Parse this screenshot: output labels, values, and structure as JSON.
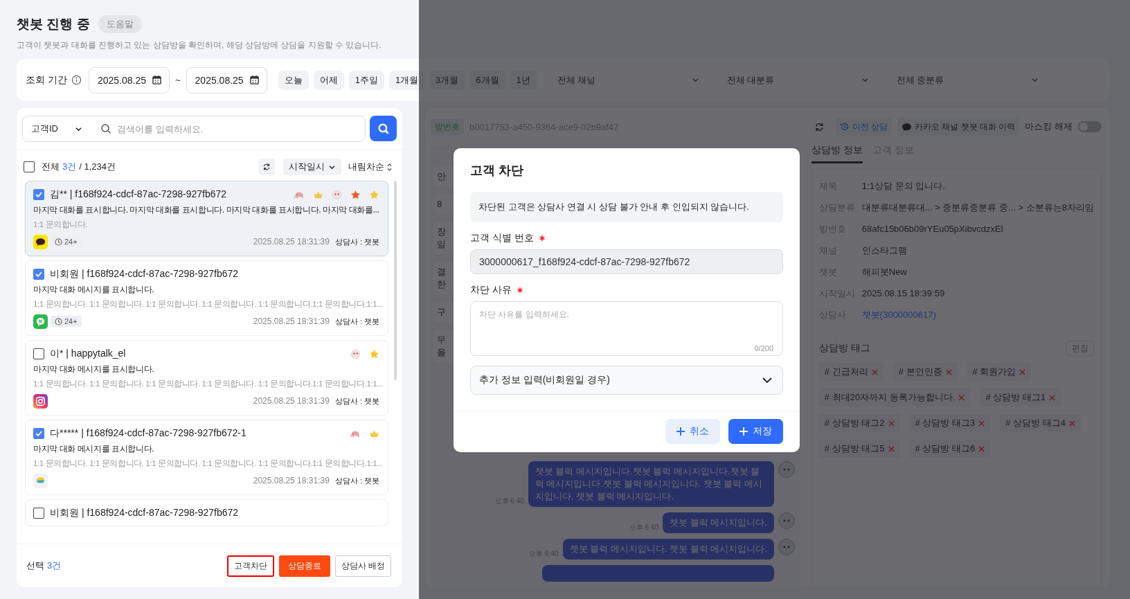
{
  "page": {
    "title": "챗봇 진행 중",
    "help_button": "도움말",
    "description": "고객이 챗봇과 대화를 진행하고 있는 상담방을 확인하며, 해당 상담방에 상담을 지원할 수 있습니다."
  },
  "filters": {
    "period_label": "조회 기간",
    "start_date": "2025.08.25",
    "separator": "~",
    "end_date": "2025.08.25",
    "quick_ranges": [
      {
        "label": "오늘"
      },
      {
        "label": "어제"
      },
      {
        "label": "1주일"
      },
      {
        "label": "1개월"
      },
      {
        "label": "3개월"
      },
      {
        "label": "6개월"
      },
      {
        "label": "1년"
      }
    ],
    "selects": [
      {
        "value": "전체 채널"
      },
      {
        "value": "전체 대분류"
      },
      {
        "value": "전체 중분류"
      }
    ]
  },
  "search": {
    "field_select": "고객ID",
    "placeholder": "검색어를 입력하세요."
  },
  "list_header": {
    "select_all_checked": false,
    "all_label": "전체",
    "count": "3건",
    "total": "/ 1,234건",
    "sort": "시작일시",
    "order": "내림차순"
  },
  "conversations": [
    {
      "checked": true,
      "selected": true,
      "title": "김** | f168f924-cdcf-87ac-7298-927fb672",
      "message": "마지막 대화를 표시합니다.  마지막 대화를 표시합니다. 마지막 대화를 표시합니다. 마지막 대화를...",
      "sub": "1:1 문의합니다.",
      "channel": {
        "kind": "kakao"
      },
      "wait": "24+",
      "time": "2025.08.25 18:31:39",
      "agent": "상담사 : 챗봇",
      "badges": [
        {
          "kind": "elephant"
        },
        {
          "kind": "crown"
        },
        {
          "kind": "face"
        },
        {
          "kind": "star",
          "color": "#f2592a"
        },
        {
          "kind": "star",
          "color": "#f7c52b"
        }
      ]
    },
    {
      "checked": true,
      "selected": false,
      "title": "비회원 | f168f924-cdcf-87ac-7298-927fb672",
      "message": "마지막 대화 메시지를 표시합니다.",
      "sub": "1:1 문의합니다. 1:1 문의합니다. 1:1 문의합니다. 1:1 문의합니다. 1:1 문의합니다.1:1 문의합니다.1:1...",
      "channel": {
        "kind": "green"
      },
      "wait": "24+",
      "time": "2025.08.25 18:31:39",
      "agent": "상담사 : 챗봇"
    },
    {
      "checked": false,
      "selected": false,
      "title": "이* | happytalk_el",
      "message": "마지막 대화 메시지를 표시합니다.",
      "sub": "1:1 문의합니다. 1:1 문의합니다. 1:1 문의합니다. 1:1 문의합니다. 1:1 문의합니다.1:1 문의합니다.1:1...",
      "channel": {
        "kind": "instagram"
      },
      "time": "2025.08.25 18:31:39",
      "agent": "상담사 : 챗봇",
      "badges": [
        {
          "kind": "face"
        },
        {
          "kind": "star",
          "color": "#f7c52b"
        }
      ]
    },
    {
      "checked": true,
      "selected": false,
      "title": "다***** | f168f924-cdcf-87ac-7298-927fb672-1",
      "message": "마지막 대화 메시지를 표시합니다.",
      "sub": "1:1 문의합니다. 1:1 문의합니다. 1:1 문의합니다. 1:1 문의합니다. 1:1 문의합니다.1:1 문의합니다.1:1...",
      "channel": {
        "kind": "other"
      },
      "time": "2025.08.25 18:31:39",
      "agent": "상담사 : 챗봇",
      "badges": [
        {
          "kind": "elephant"
        },
        {
          "kind": "crown"
        }
      ]
    },
    {
      "checked": false,
      "selected": false,
      "title": "비회원 | f168f924-cdcf-87ac-7298-927fb672"
    }
  ],
  "footer": {
    "selected_label": "선택",
    "selected_count": "3건",
    "actions": [
      {
        "label": "고객차단",
        "kind": "outline",
        "highlighted": true
      },
      {
        "label": "상담종료",
        "kind": "danger",
        "highlighted": false
      },
      {
        "label": "상담사 배정",
        "kind": "outline",
        "highlighted": false
      }
    ]
  },
  "chat": {
    "room_label": "방번호",
    "room_id": "b0017753-a450-9364-ace9-02b9af47",
    "history_button": "이전 상담",
    "kakao_button": "카카오 채널 챗봇 대화 이력",
    "masking_label": "마스킹 해제",
    "masking_on": false,
    "side_cards": [
      {
        "lines": [
          "안"
        ]
      },
      {
        "lines": [
          "8"
        ]
      },
      {
        "lines": [
          "장",
          "일"
        ]
      },
      {
        "lines": [
          "결",
          "한"
        ]
      },
      {
        "lines": [
          "구"
        ]
      },
      {
        "lines": [
          "무",
          "을"
        ]
      }
    ],
    "messages": [
      {
        "text": "챗봇 블럭 메시지입니다.챗봇 블럭 메시지입니다.챗봇 블럭 메시지입니다.챗봇 블럭 메시지입니다. 챗봇 블럭 메시지입니다. 챗봇 블럭 메시지입니다.",
        "time": "오후 6:40"
      },
      {
        "text": "챗봇 블럭 메시지입니다.",
        "time": "오후 6:40"
      },
      {
        "text": "챗봇 블럭 메시지입니다. 챗봇 블럭 메시지입니다.",
        "time": "오후 6:40"
      }
    ]
  },
  "info": {
    "tabs": [
      {
        "label": "상담방 정보",
        "selected": true
      },
      {
        "label": "고객 정보",
        "selected": false
      }
    ],
    "rows": [
      {
        "label": "제목",
        "value": "1:1상담 문의 입니다.",
        "kind": "text"
      },
      {
        "label": "상담분류",
        "value": "대분류대분류대... > 중분류중분류 중... > 소분류는8자리임",
        "kind": "text"
      },
      {
        "label": "방번호",
        "value": "68afc15b06b09rYEu05pXibvcdzxEl",
        "kind": "text"
      },
      {
        "label": "채널",
        "value": "인스타그램",
        "kind": "text"
      },
      {
        "label": "챗봇",
        "value": "해피봇New",
        "kind": "text"
      },
      {
        "label": "시작일시",
        "value": "2025.08.15 18:39:59",
        "kind": "text"
      },
      {
        "label": "상담사",
        "value": "챗봇(3000000617)",
        "kind": "link"
      }
    ],
    "tags_title": "상담방 태그",
    "edit_button": "편집",
    "tags": [
      "# 긴급처리",
      "# 본인인증",
      "# 회원가입",
      "# 최대20자까지 등록가능합니다.",
      "# 상담방 태그1",
      "# 상담방 태그2",
      "# 상담방 태그3",
      "# 상담방 태그4",
      "# 상담방 태그5",
      "# 상담방 태그6"
    ]
  },
  "modal": {
    "title": "고객 차단",
    "notice": "차단된 고객은 상담사 연결 시 상담 불가 안내 후 인입되지 않습니다.",
    "id_label": "고객 식별 번호",
    "id_required": true,
    "id_value": "3000000617_f168f924-cdcf-87ac-7298-927fb672",
    "reason_label": "차단 사유",
    "reason_required": true,
    "reason_placeholder": "차단 사유를 입력하세요.",
    "counter": "0/200",
    "accordion": "추가 정보 입력(비회원일 경우)",
    "expanded": false,
    "cancel": "취소",
    "save": "저장"
  }
}
